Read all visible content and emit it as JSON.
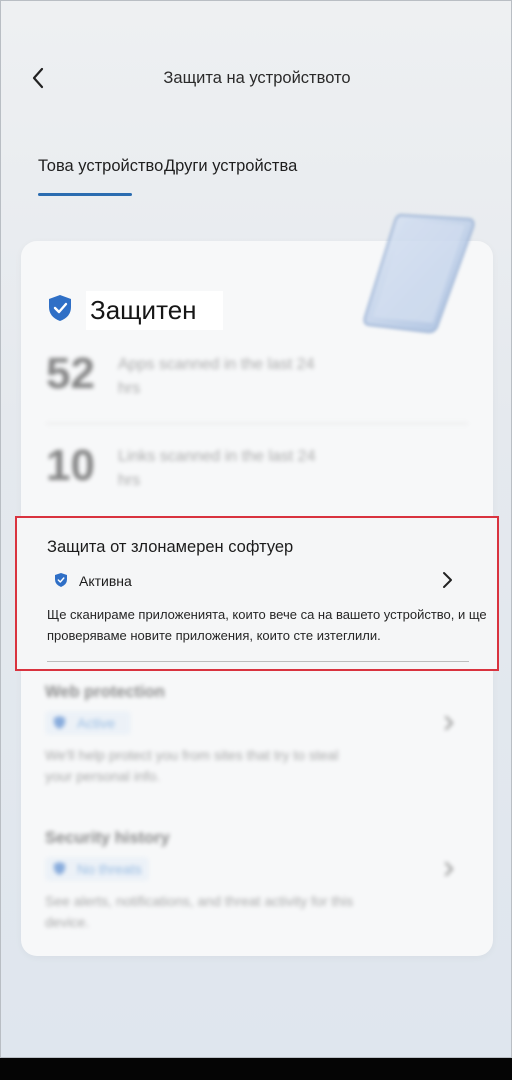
{
  "header": {
    "back_icon": "chevron-left-icon",
    "title": "Защита на устройството"
  },
  "tabs": [
    {
      "label": "Това устройство",
      "selected": true
    },
    {
      "label": "Други устройства",
      "selected": false
    }
  ],
  "status": {
    "icon": "shield-icon",
    "text": "Защитен"
  },
  "stats": [
    {
      "value": "52",
      "label": "Apps scanned in the last 24 hrs"
    },
    {
      "value": "10",
      "label": "Links scanned in the last 24 hrs"
    }
  ],
  "malware_section": {
    "title": "Защита от злонамерен софтуер",
    "status_icon": "shield-icon",
    "status_label": "Активна",
    "chevron_icon": "chevron-right-icon",
    "description": "Ще сканираме приложенията, които вече са на вашето устройство, и ще проверяваме новите приложения, които сте изтеглили."
  },
  "web_section": {
    "title": "Web protection",
    "status_label": "Active",
    "description": "We'll help protect you from sites that try to steal your personal info."
  },
  "history_section": {
    "title": "Security history",
    "status_label": "No threats",
    "description": "See alerts, notifications, and threat activity for this device."
  },
  "colors": {
    "accent": "#2b6cb0",
    "highlight_border": "#d9333f",
    "shield": "#2f6fc6"
  }
}
